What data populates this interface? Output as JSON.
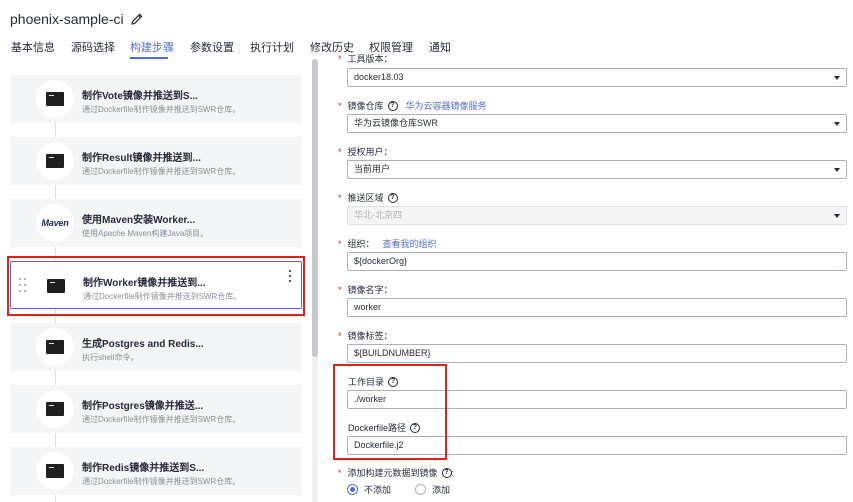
{
  "header": {
    "title": "phoenix-sample-ci"
  },
  "tabs": [
    {
      "label": "基本信息"
    },
    {
      "label": "源码选择"
    },
    {
      "label": "构建步骤"
    },
    {
      "label": "参数设置"
    },
    {
      "label": "执行计划"
    },
    {
      "label": "修改历史"
    },
    {
      "label": "权限管理"
    },
    {
      "label": "通知"
    }
  ],
  "steps": [
    {
      "title": "制作Vote镜像并推送到S...",
      "desc": "通过Dockerfile制作镜像并推送到SWR仓库。",
      "icon": "terminal-icon"
    },
    {
      "title": "制作Result镜像并推送到...",
      "desc": "通过Dockerfile制作镜像并推送到SWR仓库。",
      "icon": "terminal-icon"
    },
    {
      "title": "使用Maven安装Worker...",
      "desc": "使用Apache Maven构建Java项目。",
      "icon": "maven-logo",
      "logo_text": "Maven"
    },
    {
      "title": "制作Worker镜像并推送到...",
      "desc": "通过Dockerfile制作镜像并推送到SWR仓库。",
      "icon": "terminal-icon"
    },
    {
      "title": "生成Postgres and Redis...",
      "desc": "执行shell命令。",
      "icon": "terminal-icon"
    },
    {
      "title": "制作Postgres镜像并推送...",
      "desc": "通过Dockerfile制作镜像并推送到SWR仓库。",
      "icon": "terminal-icon"
    },
    {
      "title": "制作Redis镜像并推送到S...",
      "desc": "通过Dockerfile制作镜像并推送到SWR仓库。",
      "icon": "terminal-icon"
    }
  ],
  "form": {
    "tool_version": {
      "label": "工具版本：",
      "value": "docker18.03"
    },
    "repo": {
      "label": "镜像仓库",
      "link": "华为云容器镜像服务",
      "value": "华为云镜像仓库SWR"
    },
    "auth_user": {
      "label": "授权用户：",
      "value": "当前用户"
    },
    "region": {
      "label": "推送区域",
      "value": "华北-北京四"
    },
    "org": {
      "label": "组织：",
      "link": "查看我的组织",
      "value": "${dockerOrg}"
    },
    "image_name": {
      "label": "镜像名字：",
      "value": "worker"
    },
    "image_tag": {
      "label": "镜像标签：",
      "value": "${BUILDNUMBER}"
    },
    "workdir": {
      "label": "工作目录",
      "value": "./worker"
    },
    "dockerfile": {
      "label": "Dockerfile路径",
      "value": "Dockerfile.j2"
    },
    "add_metadata": {
      "label": "添加构建元数据到镜像",
      "options": [
        "不添加",
        "添加"
      ],
      "selected": "不添加"
    }
  },
  "colors": {
    "accent": "#526ecc",
    "highlight": "#e0201e"
  }
}
